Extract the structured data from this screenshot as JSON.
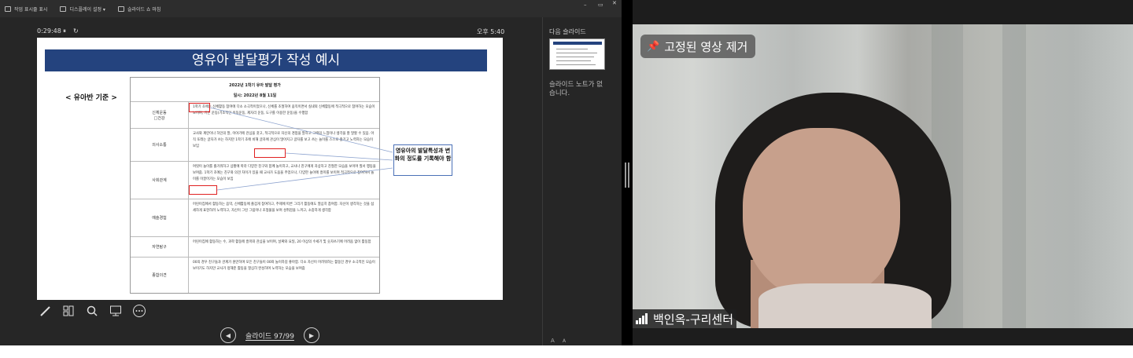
{
  "toolbar": {
    "taskbar_label": "작업 표시줄 표시",
    "display_settings_label": "디스플레이 설정 ▾",
    "end_show_label": "슬라이드 쇼 마침",
    "minimize": "–",
    "restore": "▭",
    "close": "✕"
  },
  "presenter": {
    "timer": "0:29:48",
    "pause_icon": "⏸",
    "restart_icon": "↻",
    "clock": "오후 5:40",
    "next_slide_label": "다음 슬라이드",
    "notes_text": "슬라이드 노트가 없습니다.",
    "slide_counter": "슬라이드 97/99",
    "prev_icon": "◀",
    "next_icon": "▶",
    "font_larger": "A",
    "font_smaller": "A"
  },
  "slide": {
    "title": "영유아 발달평가 작성 예시",
    "subtitle": "< 유아반 기준 >",
    "doc_title": "2022년 1학기 유아 발달 평가",
    "doc_date": "일시: 2022년 8월 11일",
    "callout": "영유아의 발달특성과 변화의 정도를 기록해야 함",
    "rows": [
      {
        "cat": "신체운동\n□건강",
        "text": "1학기 초에는 신체활동 참여에 다소 소극적이었으나, 신체를 조절하여 움직이면서 실내외 신체활동에 적극적으로 참여하는 모습이 보이며, 기본 운동(기초적인 이동운동, 제자리 운동, 도구를 이용한 운동)을 수행함"
      },
      {
        "cat": "의사소통",
        "text": "교사와 계란이나 하인의 말, 이야기에 관심을 갖고, 적극적으로 자신의 경험을 말하고 그때의 느낌이나 생각을 잘 말할 수 있음. 아직 또래는 글자가 쓰는 하지만 1학기 초에 비해 글자에 관심이 많아지고 글자를 보고 쓰는 놀이를 스스로 즐기고 노력하는 모습이 보임"
      },
      {
        "cat": "사회관계",
        "text": "여럿이 놀이를 즐거워하고 상황에 따라 다양한 친구와 함께 놀이하고, 교사나 친구에게 자상하고 친절한 모습을 보이며 질서 행동을 보여줌. 1학기 초에는 친구와 의견 차이가 있을 때 교사가 도움을 주었으나, 다양한 놀이에 흥미를 보이며 적극적으로 참여하며 놀이를 이끌어가는 모습이 보임"
      },
      {
        "cat": "예술경험",
        "text": "어린이집에서 활동하는 음악, 신체활동에 즐겁게 참여하고, 주제에 따른 그리기 활동에도 열심히 참여함. 자신이 생각하는 것을 섬세하게 표현하려 노력하고, 자신이 그린 그림이나 조형물을 보며 성취감을 느끼고, 소중하게 생각함"
      },
      {
        "cat": "자연탐구",
        "text": "어린이집에 활동하는 수, 과학 활동에 흥미와 관심을 보이며, 날짜와 요일, 20 이상의 수세기 및 숫자쓰기에 어려움 없이 활동함"
      },
      {
        "cat": "종합의견",
        "text": "00의 경우 친구들과 관계가 원만하며 모든 친구들이 00와 놀이하길 좋아함. 다소 자신이 어려워하는 활동인 경우 소극적인 모습이 보이기도 하지만 교사가 정해준 활동을 열심히 완성하며 노력하는 모습을 보여줌"
      }
    ]
  },
  "video": {
    "unpin_label": "고정된 영상 제거",
    "pin_icon": "pin-icon",
    "participant_name": "백인옥-구리센터"
  }
}
